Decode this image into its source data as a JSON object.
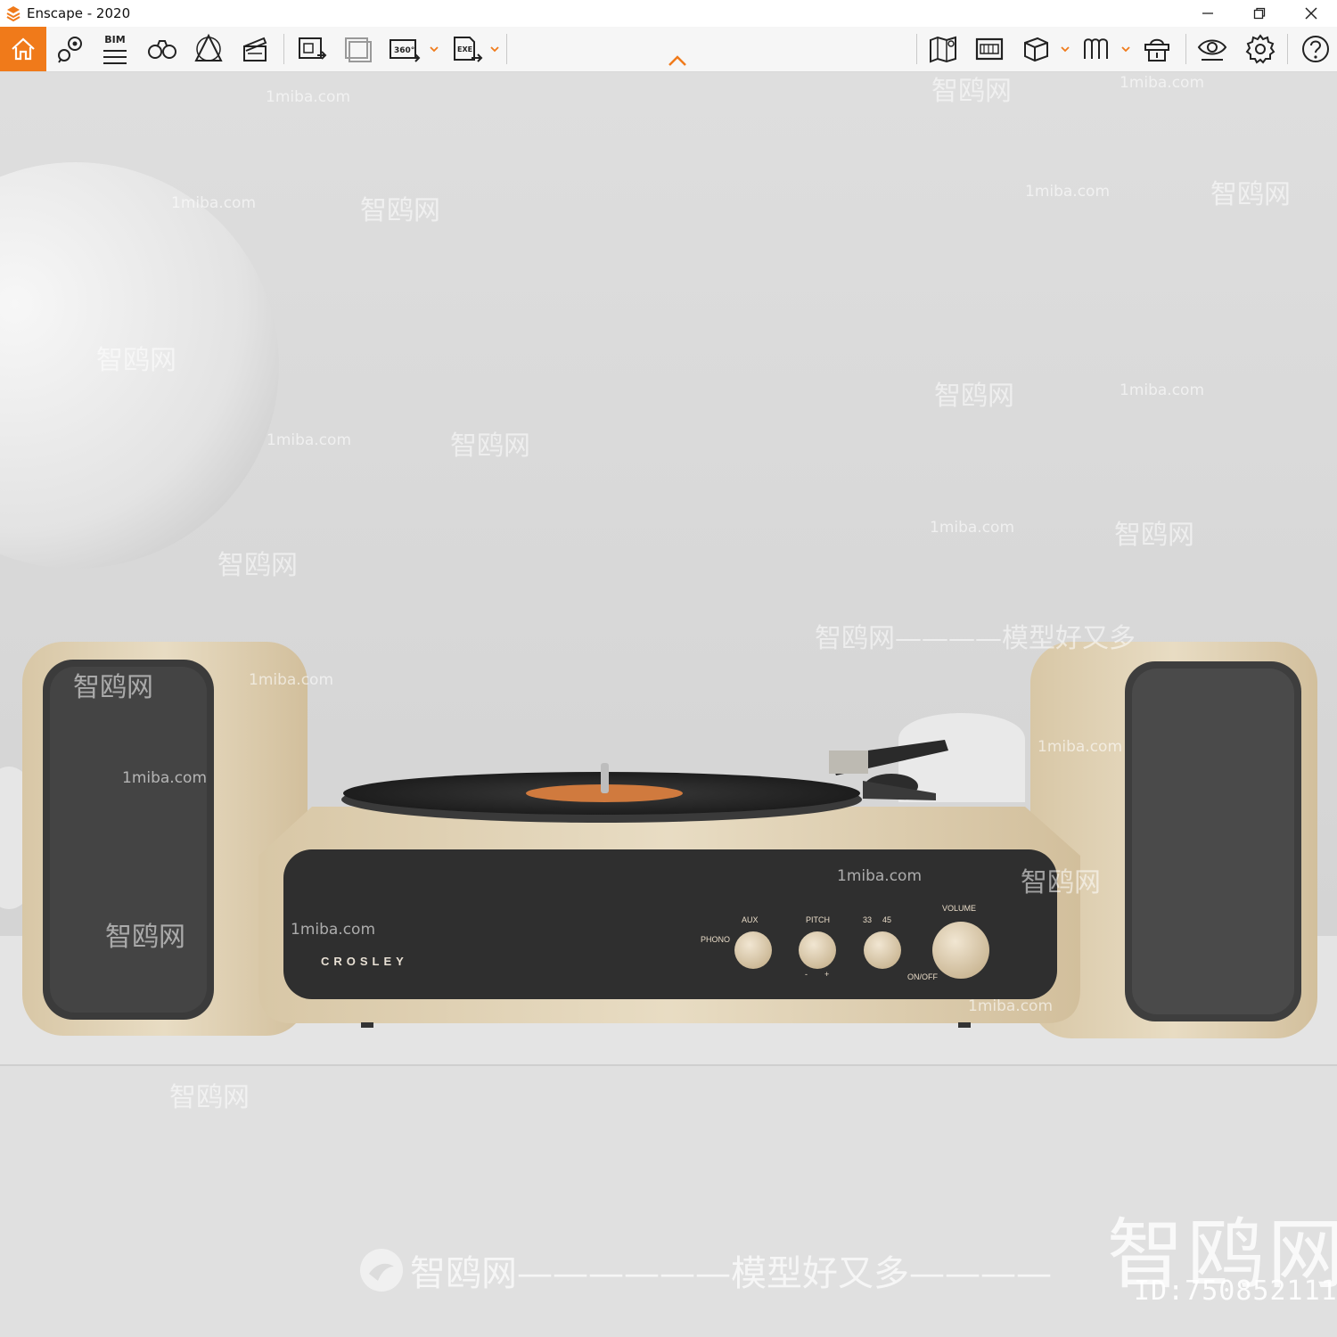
{
  "window": {
    "title": "Enscape - 2020",
    "controls": [
      "minimize",
      "restore",
      "close"
    ]
  },
  "toolbar": {
    "accent_color": "#f07a1a",
    "bim_label": "BIM",
    "items": [
      {
        "name": "home",
        "icon": "home-icon",
        "active": true
      },
      {
        "name": "views",
        "icon": "map-pin-icon"
      },
      {
        "name": "bim",
        "icon": "bim-icon"
      },
      {
        "name": "binoculars",
        "icon": "binoculars-icon"
      },
      {
        "name": "assets",
        "icon": "asset-library-icon"
      },
      {
        "name": "video",
        "icon": "clapperboard-icon"
      },
      {
        "name": "render-image",
        "icon": "render-image-icon"
      },
      {
        "name": "batch-render",
        "icon": "batch-render-icon"
      },
      {
        "name": "panorama",
        "icon": "panorama-360-icon"
      },
      {
        "name": "export-exe",
        "icon": "export-exe-icon"
      },
      {
        "name": "minimap",
        "icon": "map-icon"
      },
      {
        "name": "atlas",
        "icon": "atlas-icon"
      },
      {
        "name": "cube",
        "icon": "cube-icon"
      },
      {
        "name": "vr",
        "icon": "vr-headset-icon"
      },
      {
        "name": "collaboration",
        "icon": "people-icon"
      },
      {
        "name": "visual-settings",
        "icon": "eye-icon"
      },
      {
        "name": "settings",
        "icon": "gear-icon"
      },
      {
        "name": "help",
        "icon": "help-icon"
      }
    ]
  },
  "scene": {
    "brand": "CROSLEY",
    "labels": {
      "phono": "PHONO",
      "aux": "AUX",
      "pitch": "PITCH",
      "pitch_minus": "-",
      "pitch_plus": "+",
      "speed_33": "33",
      "speed_45": "45",
      "volume": "VOLUME",
      "onoff": "ON/OFF"
    }
  },
  "watermarks": {
    "site": "1miba.com",
    "cn": "智鸥网",
    "slogan": "智鸥网——————模型好又多————",
    "slogan2": "智鸥网————模型好又多",
    "big": "智鸥网",
    "id": "ID:750852111"
  }
}
